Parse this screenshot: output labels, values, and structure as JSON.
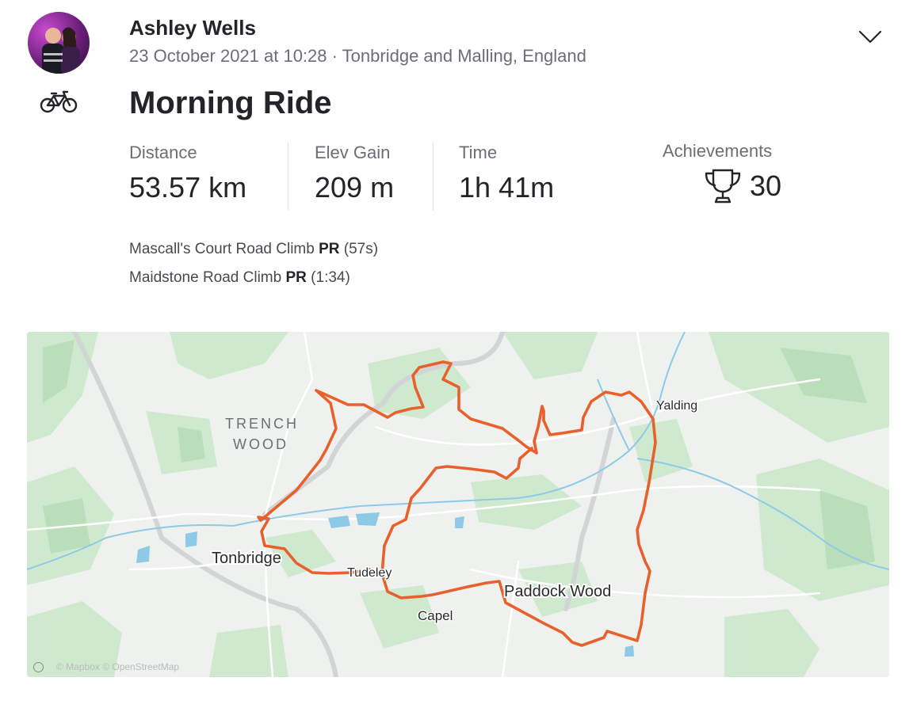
{
  "athlete": {
    "name": "Ashley Wells",
    "meta": "23 October 2021 at 10:28 · Tonbridge and Malling, England"
  },
  "activity": {
    "sport_icon": "bicycle-icon",
    "title": "Morning Ride"
  },
  "stats": [
    {
      "label": "Distance",
      "value": "53.57 km"
    },
    {
      "label": "Elev Gain",
      "value": "209 m"
    },
    {
      "label": "Time",
      "value": "1h 41m"
    }
  ],
  "achievements": {
    "label": "Achievements",
    "icon": "trophy-icon",
    "count": "30"
  },
  "segments": [
    {
      "name": "Mascall's Court Road Climb",
      "badge": "PR",
      "time": "(57s)"
    },
    {
      "name": "Maidstone Road Climb",
      "badge": "PR",
      "time": "(1:34)"
    }
  ],
  "map": {
    "route_color": "#e8602c",
    "labels": {
      "trench_wood_1": "TRENCH",
      "trench_wood_2": "WOOD",
      "tonbridge": "Tonbridge",
      "tudeley": "Tudeley",
      "capel": "Capel",
      "paddock_wood": "Paddock Wood",
      "yalding": "Yalding"
    },
    "attribution": "© Mapbox © OpenStreetMap"
  },
  "colors": {
    "text_primary": "#242428",
    "text_secondary": "#6d6d78",
    "map_water": "#8ecae6",
    "map_green": "#cfe9cf"
  }
}
